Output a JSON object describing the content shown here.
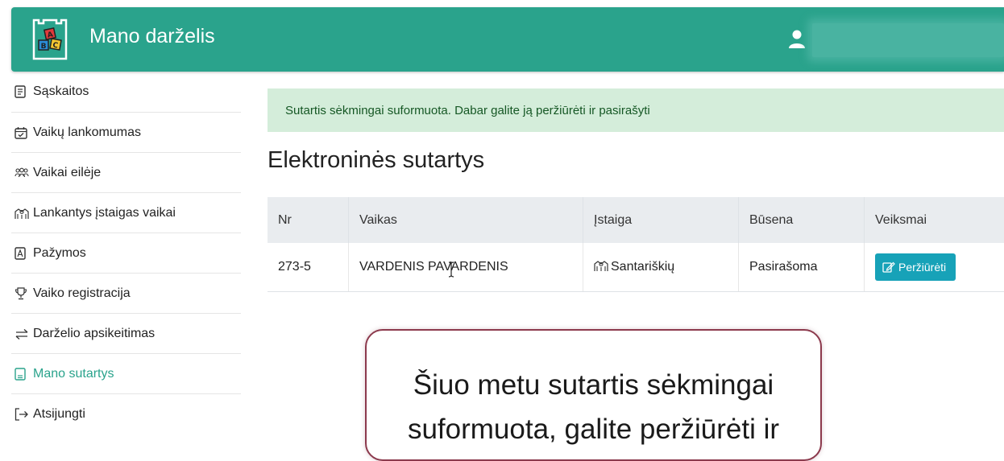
{
  "header": {
    "app_title": "Mano darželis",
    "logo_letters": [
      "A",
      "B",
      "C"
    ]
  },
  "sidebar": {
    "items": [
      {
        "label": "Sąskaitos",
        "icon": "receipt-icon"
      },
      {
        "label": "Vaikų lankomumas",
        "icon": "calendar-check-icon"
      },
      {
        "label": "Vaikai eilėje",
        "icon": "people-icon"
      },
      {
        "label": "Lankantys įstaigas vaikai",
        "icon": "building-icon"
      },
      {
        "label": "Pažymos",
        "icon": "pdf-file-icon"
      },
      {
        "label": "Vaiko registracija",
        "icon": "trophy-icon"
      },
      {
        "label": "Darželio apsikeitimas",
        "icon": "swap-arrows-icon"
      },
      {
        "label": "Mano sutartys",
        "icon": "document-icon",
        "active": true
      },
      {
        "label": "Atsijungti",
        "icon": "logout-icon"
      }
    ]
  },
  "alert": {
    "text": "Sutartis sėkmingai suformuota. Dabar galite ją peržiūrėti ir pasirašyti"
  },
  "page": {
    "title": "Elektroninės sutartys"
  },
  "table": {
    "headers": [
      "Nr",
      "Vaikas",
      "Įstaiga",
      "Būsena",
      "Veiksmai"
    ],
    "rows": [
      {
        "nr": "273-5",
        "vaikas": "VARDENIS PAVARDENIS",
        "istaiga": "Santariškių",
        "busena": "Pasirašoma",
        "action": "Peržiūrėti"
      }
    ]
  },
  "callout": {
    "line1": "Šiuo metu sutartis sėkmingai",
    "line2": "suformuota, galite peržiūrėti ir"
  },
  "colors": {
    "header_bg": "#2aa38c",
    "alert_bg": "#d4edda",
    "button_bg": "#17a2b8",
    "callout_border": "#8c3a4d"
  }
}
